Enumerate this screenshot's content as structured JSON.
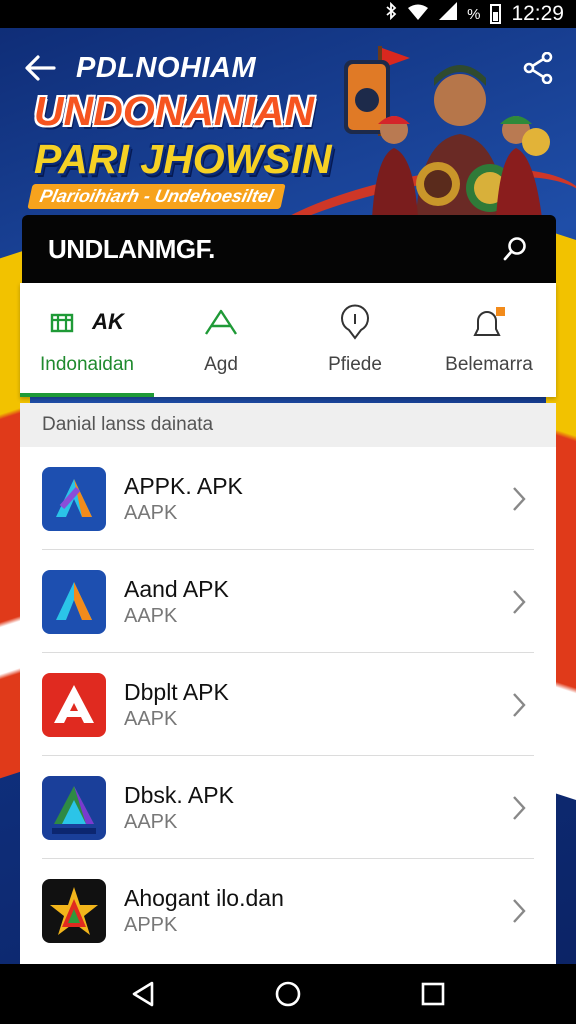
{
  "status_bar": {
    "time": "12:29",
    "percent_glyph": "%"
  },
  "hero": {
    "subtitle": "PDLNOHIAM",
    "title_line1": "UNDONANIAN",
    "title_line2": "PARI JHOWSIN",
    "tagline": "Plarioihiarh - Undehoesiltel"
  },
  "toolbar": {
    "title": "UNDLANMGF."
  },
  "tabs": [
    {
      "label": "Indonaidan",
      "icon": "store-icon",
      "badge": "AK",
      "active": true
    },
    {
      "label": "Agd",
      "icon": "triangle-icon",
      "active": false
    },
    {
      "label": "Pfiede",
      "icon": "pin-icon",
      "active": false
    },
    {
      "label": "Belemarra",
      "icon": "bell-icon",
      "active": false
    }
  ],
  "list": {
    "header": "Danial lanss dainata",
    "items": [
      {
        "name": "APPK. APK",
        "sub": "AAPK",
        "icon": "blue-a-app-icon"
      },
      {
        "name": "Aand APK",
        "sub": "AAPK",
        "icon": "blue-orange-a-app-icon"
      },
      {
        "name": "Dbplt APK",
        "sub": "AAPK",
        "icon": "red-a-app-icon"
      },
      {
        "name": "Dbsk. APK",
        "sub": "AAPK",
        "icon": "gradient-a-app-icon"
      },
      {
        "name": "Ahogant ilo.dan",
        "sub": "APPK",
        "icon": "star-app-icon"
      }
    ]
  },
  "colors": {
    "accent_green": "#1f9a37",
    "toolbar_bg": "#050505",
    "hero_blue": "#1f4ea8",
    "hero_orange": "#f6541f",
    "hero_yellow": "#f6d125"
  }
}
